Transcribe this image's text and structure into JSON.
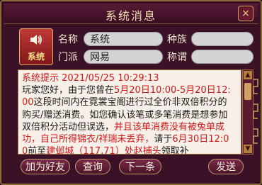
{
  "window": {
    "title": "系统消息",
    "close_label": "×"
  },
  "sender": {
    "badge": "系统",
    "name_label": "名称",
    "name_value": "系统",
    "race_label": "种族",
    "race_value": "",
    "sect_label": "门派",
    "sect_value": "网易",
    "title_label": "称谓",
    "title_value": ""
  },
  "message": {
    "header": "系统提示 2021/05/25 10:29:13",
    "p1": "玩家您好，由于您曾在",
    "time_range": "5月20日10:00-5月20日12:00",
    "p2": "这段时间内在霓裳宝阁进行过全价非双倍积分的购买/赠送消费。如您确认该笔或多笔消费是想参加双倍积分活动但误选，",
    "p3_red": "并且该单消费没有被兔单成功，自己所得锦衣/祥瑞未丢弃，",
    "p4": "请于",
    "deadline": "6月30日12:00",
    "p5": "前至",
    "location": "建邺城（117,71）处赵捕头",
    "p6": "领取补"
  },
  "scrollbar": {
    "up": "▲",
    "down": "▼"
  },
  "buttons": {
    "add_friend": "加为好友",
    "query": "查询",
    "next": "下一条",
    "send": "发送"
  }
}
